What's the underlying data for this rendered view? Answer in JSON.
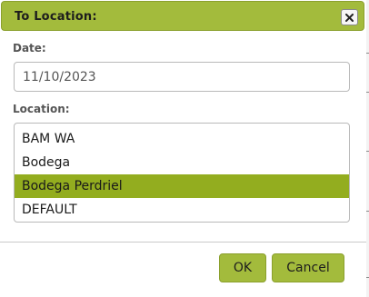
{
  "dialog": {
    "title": "To Location:",
    "close_icon": "close-icon"
  },
  "date": {
    "label": "Date:",
    "value": "11/10/2023"
  },
  "location": {
    "label": "Location:",
    "options": [
      "BAM WA",
      "Bodega",
      "Bodega Perdriel",
      "DEFAULT"
    ],
    "selected": "Bodega Perdriel"
  },
  "buttons": {
    "ok_label": "OK",
    "cancel_label": "Cancel"
  },
  "colors": {
    "accent": "#a3bb3c",
    "selected_row": "#93ad1f"
  }
}
